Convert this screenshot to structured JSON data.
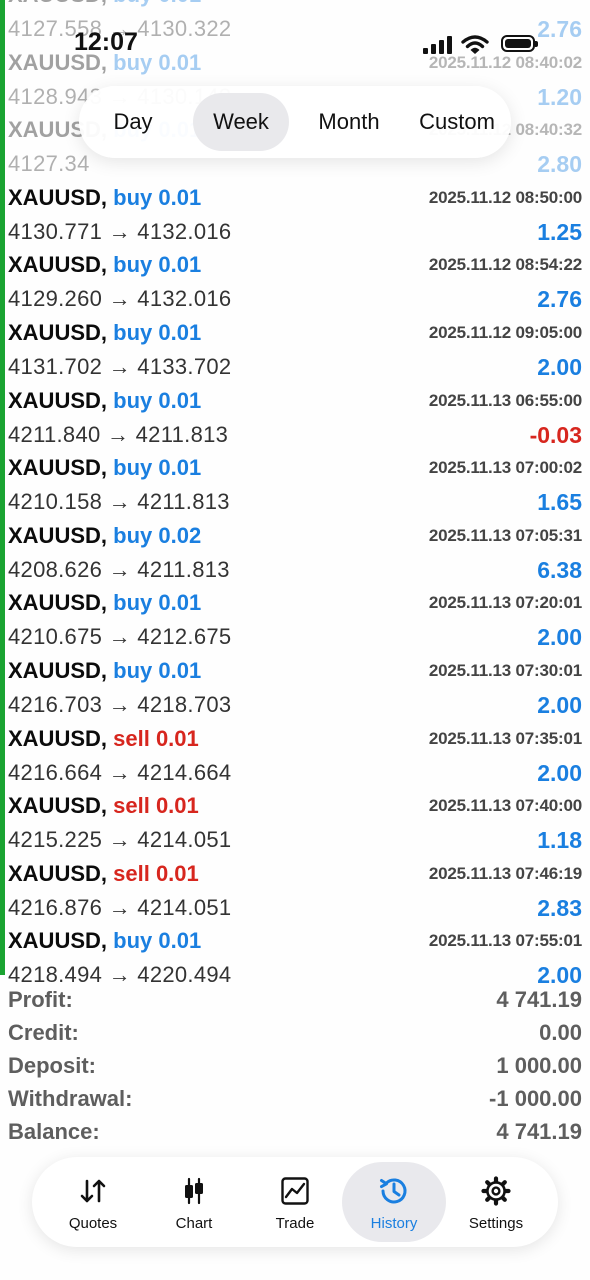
{
  "status_bar": {
    "time": "12:07",
    "icons": [
      "signal-icon",
      "wifi-icon",
      "battery-icon"
    ]
  },
  "period_tabs": [
    {
      "label": "Day",
      "active": false
    },
    {
      "label": "Week",
      "active": true
    },
    {
      "label": "Month",
      "active": false
    },
    {
      "label": "Custom",
      "active": false
    }
  ],
  "trades": [
    {
      "symbol": "XAUUSD,",
      "direction": "buy 0.01",
      "time": "",
      "prices": "4127.558 → 4130.322",
      "profit": "2.76"
    },
    {
      "symbol": "XAUUSD,",
      "direction": "buy 0.01",
      "time": "2025.11.12 08:40:02",
      "prices": "4128.943 → 4130.143",
      "profit": "1.20"
    },
    {
      "symbol": "XAUUSD,",
      "direction": "buy 0.01",
      "time": "2025.11.12 08:40:32",
      "prices": "4127.34",
      "profit": "2.80"
    },
    {
      "symbol": "XAUUSD,",
      "direction": "buy 0.01",
      "time": "2025.11.12 08:50:00",
      "prices": "4130.771 → 4132.016",
      "profit": "1.25"
    },
    {
      "symbol": "XAUUSD,",
      "direction": "buy 0.01",
      "time": "2025.11.12 08:54:22",
      "prices": "4129.260 → 4132.016",
      "profit": "2.76"
    },
    {
      "symbol": "XAUUSD,",
      "direction": "buy 0.01",
      "time": "2025.11.12 09:05:00",
      "prices": "4131.702 → 4133.702",
      "profit": "2.00"
    },
    {
      "symbol": "XAUUSD,",
      "direction": "buy 0.01",
      "time": "2025.11.13 06:55:00",
      "prices": "4211.840 → 4211.813",
      "profit": "-0.03"
    },
    {
      "symbol": "XAUUSD,",
      "direction": "buy 0.01",
      "time": "2025.11.13 07:00:02",
      "prices": "4210.158 → 4211.813",
      "profit": "1.65"
    },
    {
      "symbol": "XAUUSD,",
      "direction": "buy 0.02",
      "time": "2025.11.13 07:05:31",
      "prices": "4208.626 → 4211.813",
      "profit": "6.38"
    },
    {
      "symbol": "XAUUSD,",
      "direction": "buy 0.01",
      "time": "2025.11.13 07:20:01",
      "prices": "4210.675 → 4212.675",
      "profit": "2.00"
    },
    {
      "symbol": "XAUUSD,",
      "direction": "buy 0.01",
      "time": "2025.11.13 07:30:01",
      "prices": "4216.703 → 4218.703",
      "profit": "2.00"
    },
    {
      "symbol": "XAUUSD,",
      "direction": "sell 0.01",
      "time": "2025.11.13 07:35:01",
      "prices": "4216.664 → 4214.664",
      "profit": "2.00"
    },
    {
      "symbol": "XAUUSD,",
      "direction": "sell 0.01",
      "time": "2025.11.13 07:40:00",
      "prices": "4215.225 → 4214.051",
      "profit": "1.18"
    },
    {
      "symbol": "XAUUSD,",
      "direction": "sell 0.01",
      "time": "2025.11.13 07:46:19",
      "prices": "4216.876 → 4214.051",
      "profit": "2.83"
    },
    {
      "symbol": "XAUUSD,",
      "direction": "buy 0.01",
      "time": "2025.11.13 07:55:01",
      "prices": "4218.494 → 4220.494",
      "profit": "2.00"
    }
  ],
  "summary": [
    {
      "label": "Profit:",
      "value": "4 741.19"
    },
    {
      "label": "Credit:",
      "value": "0.00"
    },
    {
      "label": "Deposit:",
      "value": "1 000.00"
    },
    {
      "label": "Withdrawal:",
      "value": "-1 000.00"
    },
    {
      "label": "Balance:",
      "value": "4 741.19"
    }
  ],
  "nav": [
    {
      "label": "Quotes",
      "icon": "quotes-arrows-icon",
      "active": false
    },
    {
      "label": "Chart",
      "icon": "candlestick-icon",
      "active": false
    },
    {
      "label": "Trade",
      "icon": "trade-chart-icon",
      "active": false
    },
    {
      "label": "History",
      "icon": "history-clock-icon",
      "active": true
    },
    {
      "label": "Settings",
      "icon": "gear-icon",
      "active": false
    }
  ],
  "colors": {
    "buy": "#1a7fe0",
    "sell": "#d7261e",
    "profit_positive": "#1a7fe0",
    "profit_negative": "#d7261e",
    "accent_bar": "#1aa331"
  }
}
